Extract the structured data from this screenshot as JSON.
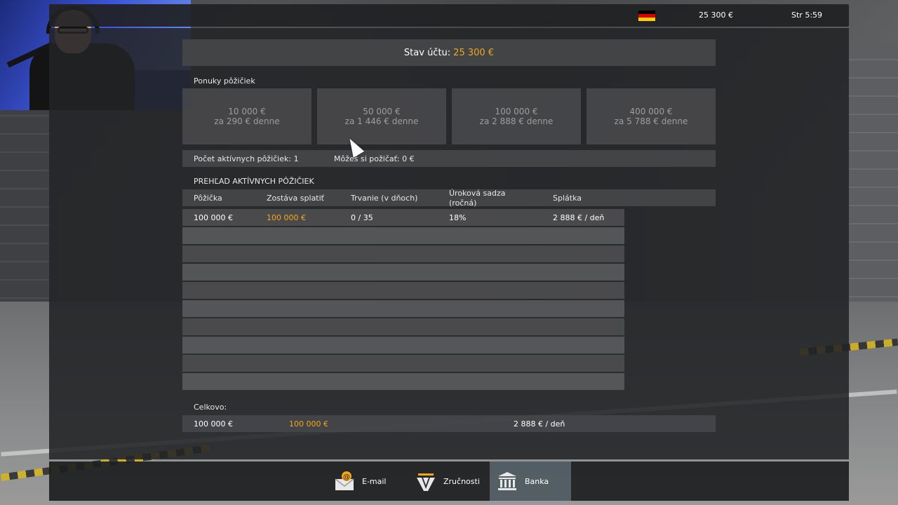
{
  "topbar": {
    "flag_icon": "germany-flag-icon",
    "money": "25 300 €",
    "clock": "Str 5:59"
  },
  "balance": {
    "label": "Stav účtu:",
    "value": "25 300 €"
  },
  "offers": {
    "title": "Ponuky pôžičiek",
    "items": [
      {
        "amount": "10 000 €",
        "rate": "za 290 € denne"
      },
      {
        "amount": "50 000 €",
        "rate": "za 1 446 € denne"
      },
      {
        "amount": "100 000 €",
        "rate": "za 2 888 € denne"
      },
      {
        "amount": "400 000 €",
        "rate": "za 5 788 € denne"
      }
    ]
  },
  "info": {
    "active_count": "Počet aktívnych pôžičiek: 1",
    "can_borrow": "Môžeš si požičať: 0 €"
  },
  "overview": {
    "title": "PREHĽAD AKTÍVNYCH PÔŽIČIEK",
    "columns": [
      "Pôžička",
      "Zostáva splatiť",
      "Trvanie (v dňoch)",
      "Úroková sadza",
      "(ročná)",
      "Splátka"
    ],
    "rows": [
      {
        "loan": "100 000 €",
        "remaining": "100 000 €",
        "duration": "0 / 35",
        "rate": "18%",
        "installment": "2 888 € / deň"
      }
    ]
  },
  "totals": {
    "label": "Celkovo:",
    "loan": "100 000 €",
    "remaining": "100 000 €",
    "installment": "2 888 € / deň"
  },
  "nav": {
    "items": [
      {
        "label": "E-mail",
        "icon": "email-icon"
      },
      {
        "label": "Zručnosti",
        "icon": "skills-icon"
      },
      {
        "label": "Banka",
        "icon": "bank-icon"
      }
    ],
    "active": "Banka"
  },
  "colors": {
    "accent": "#f0a81a",
    "panel": "#222325",
    "active_tab": "#5f7480"
  }
}
